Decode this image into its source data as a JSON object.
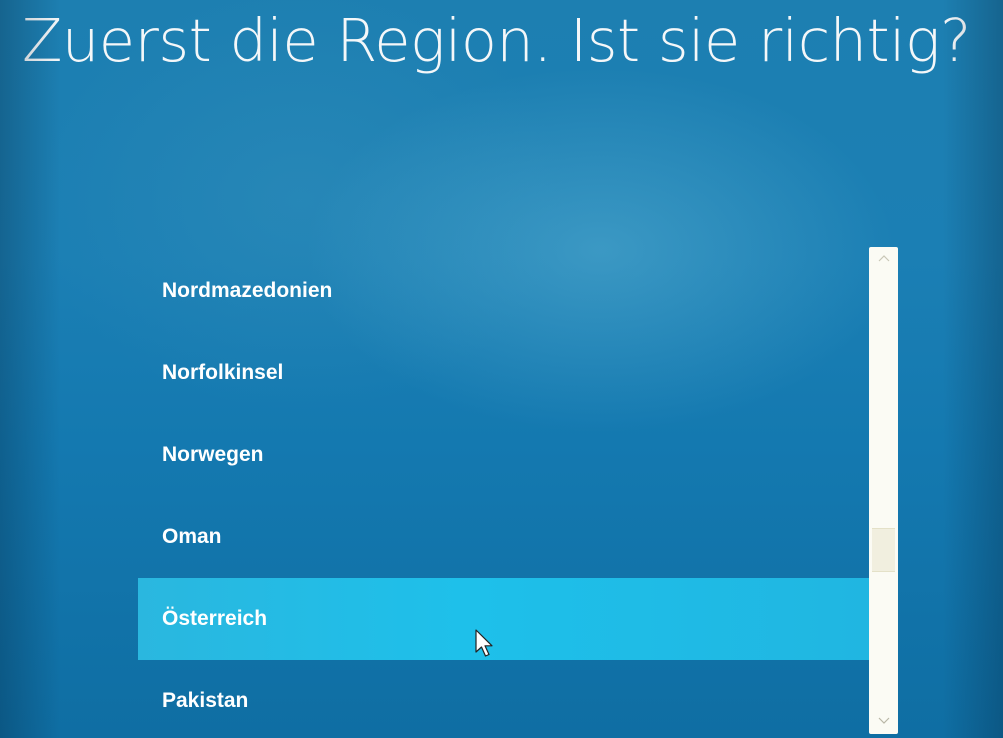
{
  "header": {
    "title": "Zuerst die Region. Ist sie richtig?"
  },
  "region_list": {
    "items": [
      {
        "label": "Nordmazedonien",
        "selected": false
      },
      {
        "label": "Norfolkinsel",
        "selected": false
      },
      {
        "label": "Norwegen",
        "selected": false
      },
      {
        "label": "Oman",
        "selected": false
      },
      {
        "label": "Österreich",
        "selected": true
      },
      {
        "label": "Pakistan",
        "selected": false
      }
    ],
    "selected_index": 4
  },
  "scrollbar": {
    "up_icon": "chevron-up-icon",
    "down_icon": "chevron-down-icon",
    "position_fraction": 0.65
  },
  "colors": {
    "background": "#1479b0",
    "selection": "#1ec0ea",
    "text": "#ffffff",
    "scrollbar_track": "#fbfbf4"
  }
}
